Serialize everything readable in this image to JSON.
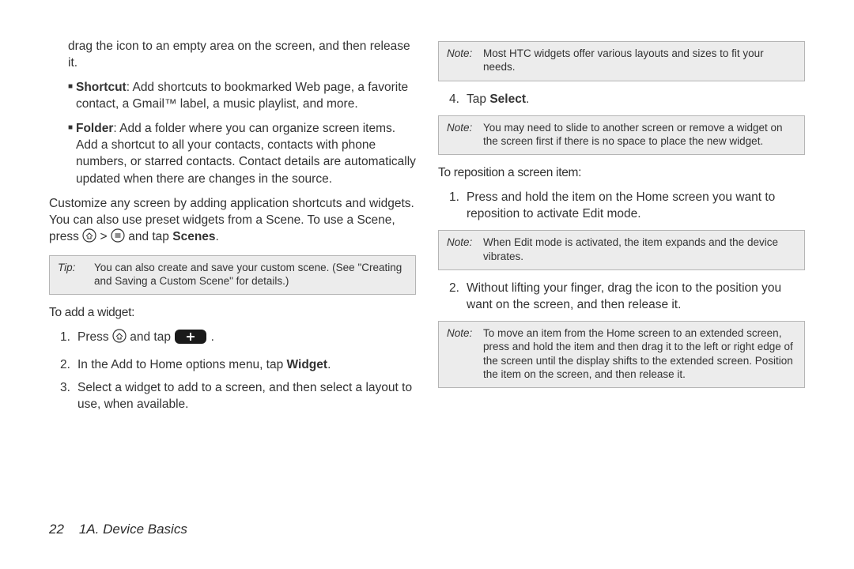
{
  "col1": {
    "drag_para": "drag the icon to an empty area on the screen, and then release it.",
    "shortcut_label": "Shortcut",
    "shortcut_text": ": Add shortcuts to bookmarked Web page, a favorite contact, a Gmail™ label, a music playlist, and more.",
    "folder_label": "Folder",
    "folder_text": ": Add a folder where you can organize screen items. Add a shortcut to all your contacts, contacts with phone numbers, or starred contacts. Contact details are automatically updated when there are changes in the source.",
    "customize_pre": "Customize any screen by adding application shortcuts and widgets. You can also use preset widgets from a Scene. To use a Scene, press ",
    "customize_mid": " > ",
    "customize_post": " and tap ",
    "scenes_label": "Scenes",
    "tip_label": "Tip:",
    "tip_body": "You can also create and save your custom scene. (See \"Creating and Saving a Custom Scene\" for details.)",
    "add_widget_heading": "To add a widget:",
    "step1_pre": "Press ",
    "step1_mid": " and tap ",
    "step1_post": ".",
    "step2_pre": "In the Add to Home options menu, tap ",
    "step2_bold": "Widget",
    "step2_post": ".",
    "step3": "Select a widget to add to a screen, and then select a layout to use, when available."
  },
  "col2": {
    "note1_label": "Note:",
    "note1_body": "Most HTC widgets offer various layouts and sizes to fit your needs.",
    "step4_pre": "Tap ",
    "step4_bold": "Select",
    "step4_post": ".",
    "note2_label": "Note:",
    "note2_body": "You may need to slide to another screen or remove a widget on the screen first if there is no space to place the new widget.",
    "reposition_heading": "To reposition a screen item:",
    "r_step1": "Press and hold the item on the Home screen you want to reposition to activate Edit mode.",
    "note3_label": "Note:",
    "note3_body": "When Edit mode is activated, the item expands and the device vibrates.",
    "r_step2": "Without lifting your finger, drag the icon to the position you want on the screen, and then release it.",
    "note4_label": "Note:",
    "note4_body": "To move an item from the Home screen to an extended screen, press and hold the item and then drag it to the left or right edge of the screen until the display shifts to the extended screen. Position the item on the screen, and then release it."
  },
  "footer": {
    "page_num": "22",
    "section": "1A. Device Basics"
  },
  "labels": {
    "num1": "1.",
    "num2": "2.",
    "num3": "3.",
    "num4": "4.",
    "bullet": "■",
    "period": "."
  }
}
